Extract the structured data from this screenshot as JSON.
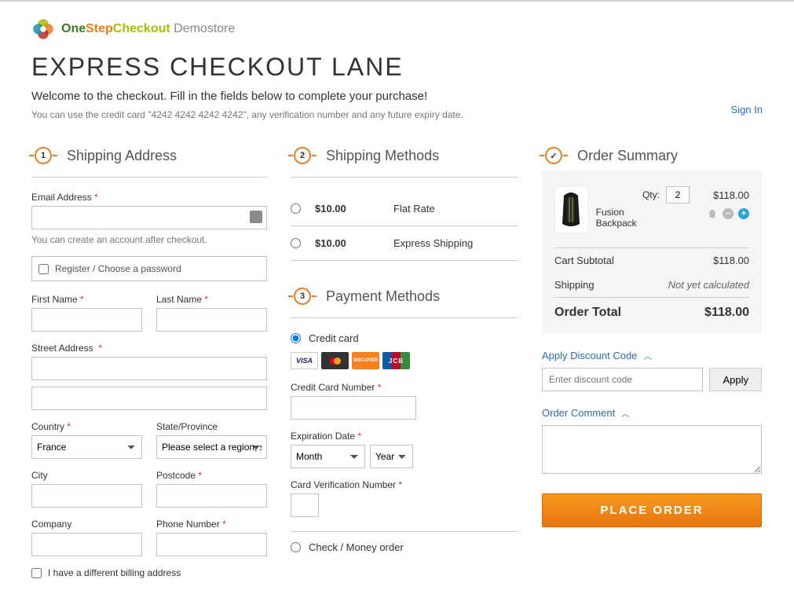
{
  "header": {
    "logo_one": "One",
    "logo_step": "Step",
    "logo_checkout": "Checkout",
    "logo_demo": " Demostore"
  },
  "page": {
    "title": "EXPRESS CHECKOUT LANE",
    "welcome": "Welcome to the checkout. Fill in the fields below to complete your purchase!",
    "hint": "You can use the credit card \"4242 4242 4242 4242\", any verification number and any future expiry date.",
    "signin": "Sign In"
  },
  "shipping_address": {
    "title": "Shipping Address",
    "email_label": "Email Address",
    "email_hint": "You can create an account after checkout.",
    "register_label": "Register / Choose a password",
    "first_name_label": "First Name",
    "last_name_label": "Last Name",
    "street_label": "Street Address",
    "country_label": "Country",
    "country_value": "France",
    "state_label": "State/Province",
    "state_placeholder": "Please select a region, state or province",
    "city_label": "City",
    "postcode_label": "Postcode",
    "company_label": "Company",
    "phone_label": "Phone Number",
    "diff_billing_label": "I have a different billing address"
  },
  "shipping_methods": {
    "title": "Shipping Methods",
    "options": [
      {
        "price": "$10.00",
        "label": "Flat Rate"
      },
      {
        "price": "$10.00",
        "label": "Express Shipping"
      }
    ]
  },
  "payment": {
    "title": "Payment Methods",
    "credit_card_label": "Credit card",
    "cc_number_label": "Credit Card Number",
    "exp_label": "Expiration Date",
    "month_placeholder": "Month",
    "year_placeholder": "Year",
    "cvn_label": "Card Verification Number",
    "check_label": "Check / Money order",
    "card_brands": {
      "visa": "VISA",
      "jcb": "JCB"
    }
  },
  "summary": {
    "title": "Order Summary",
    "item_name": "Fusion Backpack",
    "qty_label": "Qty:",
    "qty_value": "2",
    "item_price": "$118.00",
    "subtotal_label": "Cart Subtotal",
    "subtotal_value": "$118.00",
    "shipping_label": "Shipping",
    "shipping_value": "Not yet calculated",
    "total_label": "Order Total",
    "total_value": "$118.00"
  },
  "discount": {
    "title": "Apply Discount Code",
    "placeholder": "Enter discount code",
    "apply": "Apply"
  },
  "comment": {
    "title": "Order Comment"
  },
  "actions": {
    "place_order": "PLACE ORDER"
  }
}
